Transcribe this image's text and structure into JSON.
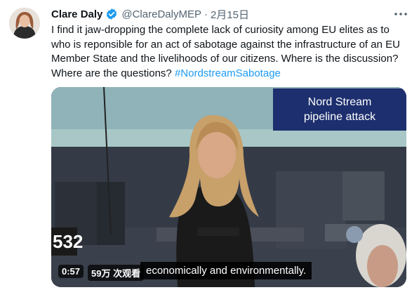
{
  "author": {
    "name": "Clare Daly",
    "handle": "@ClareDalyMEP",
    "separator": "·",
    "date": "2月15日"
  },
  "tweet": {
    "text": "I find it jaw-dropping the complete lack of curiosity among EU elites as to who is reponsible for an act of sabotage against the infrastructure of an EU Member State and the livelihoods of our citizens.  Where is the discussion? Where are the questions?",
    "hashtag": "#NordstreamSabotage"
  },
  "video": {
    "overlay_line1": "Nord Stream",
    "overlay_line2": "pipeline attack",
    "seat_number": "532",
    "duration": "0:57",
    "views": "59万 次观看",
    "subtitle": "economically and environmentally."
  },
  "colors": {
    "verified": "#1d9bf0",
    "hashtag": "#1d9bf0",
    "overlay_bg": "#1d2f6e"
  },
  "icons": [
    "verified-badge-icon",
    "more-options-icon"
  ]
}
